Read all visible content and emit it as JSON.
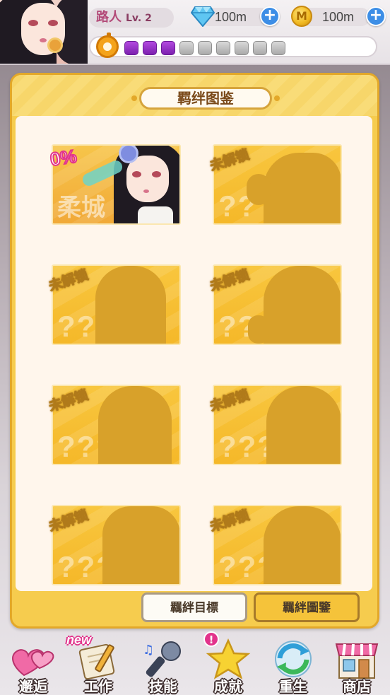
{
  "header": {
    "player_name": "路人",
    "level": "Lv. 2",
    "gems": "100m",
    "coins": "100m",
    "stamina_filled": 3,
    "stamina_total": 9
  },
  "panel": {
    "title": "羁绊图鉴",
    "cards": [
      {
        "unlocked": true,
        "progress": "0%",
        "name_fragment": "柔城"
      },
      {
        "unlocked": false,
        "label": "未解锁",
        "mystery": "???"
      },
      {
        "unlocked": false,
        "label": "未解锁",
        "mystery": "???"
      },
      {
        "unlocked": false,
        "label": "未解锁",
        "mystery": "???"
      },
      {
        "unlocked": false,
        "label": "未解锁",
        "mystery": "???"
      },
      {
        "unlocked": false,
        "label": "未解锁",
        "mystery": "???"
      },
      {
        "unlocked": false,
        "label": "未解锁",
        "mystery": "???"
      },
      {
        "unlocked": false,
        "label": "未解锁",
        "mystery": "???"
      }
    ],
    "tabs": {
      "goal_label": "羈絆目標",
      "album_label": "羈絆圖鑒"
    }
  },
  "nav": {
    "items": [
      {
        "label": "邂逅",
        "icon": "hearts-icon"
      },
      {
        "label": "工作",
        "icon": "notepad-pen-icon",
        "badge": "new"
      },
      {
        "label": "技能",
        "icon": "microphone-icon"
      },
      {
        "label": "成就",
        "icon": "star-icon",
        "badge": "!"
      },
      {
        "label": "重生",
        "icon": "refresh-arrows-icon"
      },
      {
        "label": "商店",
        "icon": "shop-icon"
      }
    ]
  },
  "colors": {
    "panel_gold": "#f6cc4e",
    "card_gold": "#f8c63e",
    "stamina_purple": "#9a33c8",
    "accent_pink": "#e2338c",
    "plus_blue": "#3d8ee6"
  }
}
